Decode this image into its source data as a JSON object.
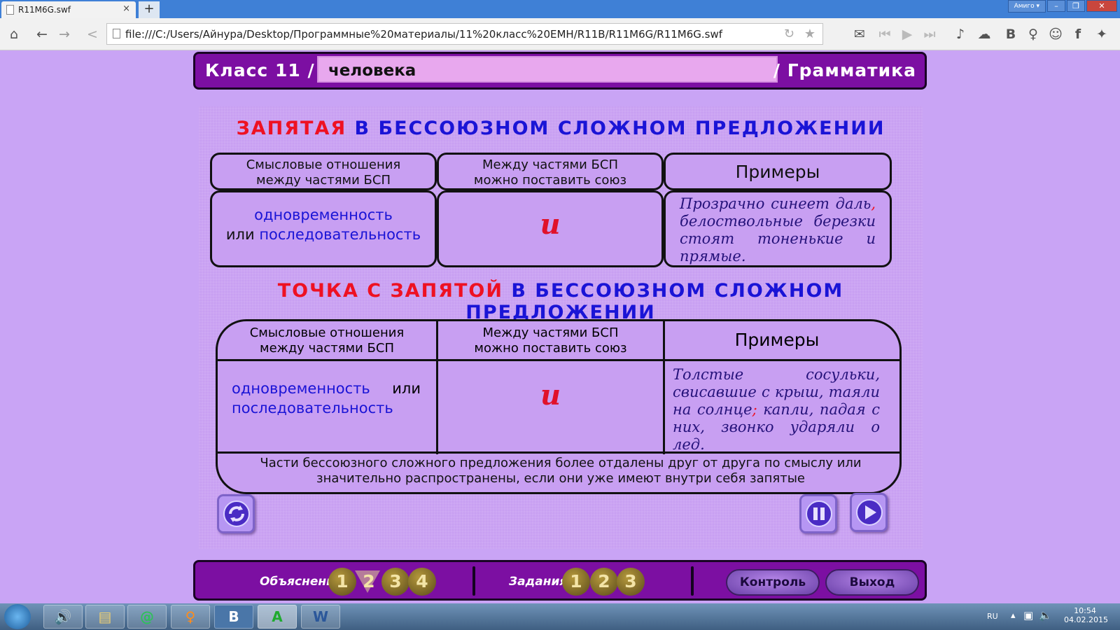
{
  "browser": {
    "tab_title": "R11M6G.swf",
    "tab_close": "×",
    "new_tab": "+",
    "brand": "Амиго",
    "url": "file:///C:/Users/Айнура/Desktop/Программные%20материалы/11%20класс%20ЕМН/R11B/R11M6G/R11M6G.swf",
    "icons": [
      "home-icon",
      "back-icon",
      "forward-icon",
      "share-icon",
      "reload-icon",
      "star-icon",
      "mail-icon",
      "rewind-icon",
      "play-icon",
      "fast-forward-icon",
      "music-icon",
      "chat-icon",
      "vk-icon",
      "odnoklassniki-icon",
      "contacts-icon",
      "facebook-icon",
      "twitter-icon"
    ],
    "toolbar_glyphs": {
      "vk": "B",
      "fb": "f"
    }
  },
  "lesson": {
    "class_label": "Класс 11 /",
    "topic": "человека",
    "section": "/ Грамматика"
  },
  "section1": {
    "title_red": "ЗАПЯТАЯ",
    "title_blue": " В БЕССОЮЗНОМ СЛОЖНОМ ПРЕДЛОЖЕНИИ",
    "col1_line1": "Смысловые отношения",
    "col1_line2": "между частями БСП",
    "col2_line1": "Между частями БСП",
    "col2_line2": "можно поставить союз",
    "col3": "Примеры",
    "relation_word1": "одновременность",
    "relation_or": "или ",
    "relation_word2": "последовательность",
    "conjunction": "и",
    "example_part1": "Прозрачно синеет даль",
    "example_punct": ",",
    "example_part2": " белоствольные березки стоят тоненькие и прямые."
  },
  "section2": {
    "title_red": "ТОЧКА С ЗАПЯТОЙ",
    "title_blue": " В БЕССОЮЗНОМ СЛОЖНОМ ПРЕДЛОЖЕНИИ",
    "col1_line1": "Смысловые отношения",
    "col1_line2": "между частями БСП",
    "col2_line1": "Между частями БСП",
    "col2_line2": "можно поставить союз",
    "col3": "Примеры",
    "relation_word1": "одновременность",
    "relation_or": "или",
    "relation_word2": "последовательность",
    "conjunction": "и",
    "example_part1": "Толстые сосульки, свисавшие с крыш, таяли на солнце",
    "example_punct": ";",
    "example_part2": "  капли, падая с них, звонко ударяли о лед.",
    "note_line1": "Части бессоюзного сложного предложения более отдалены друг от друга по смыслу или",
    "note_line2": "значительно распространены, если они уже имеют внутри себя запятые"
  },
  "nav": {
    "explanation_label": "Объяснение",
    "explanation_pages": [
      "1",
      "2",
      "3",
      "4"
    ],
    "active_page": "2",
    "tasks_label": "Задания",
    "task_pages": [
      "1",
      "2",
      "3"
    ],
    "control_button": "Контроль",
    "exit_button": "Выход"
  },
  "taskbar": {
    "lang": "RU",
    "time": "10:54",
    "date": "04.02.2015",
    "apps": [
      "windows-start",
      "speaker",
      "explorer",
      "mail-agent",
      "odnoklassniki",
      "vkontakte",
      "green-a-app",
      "word"
    ],
    "app_glyphs": {
      "vk": "B",
      "green": "A",
      "word": "W"
    }
  },
  "colors": {
    "stage_bg": "#c89ff2",
    "bar_purple": "#7c0fa2",
    "accent_red": "#ee1122",
    "accent_blue": "#1a14d6"
  }
}
